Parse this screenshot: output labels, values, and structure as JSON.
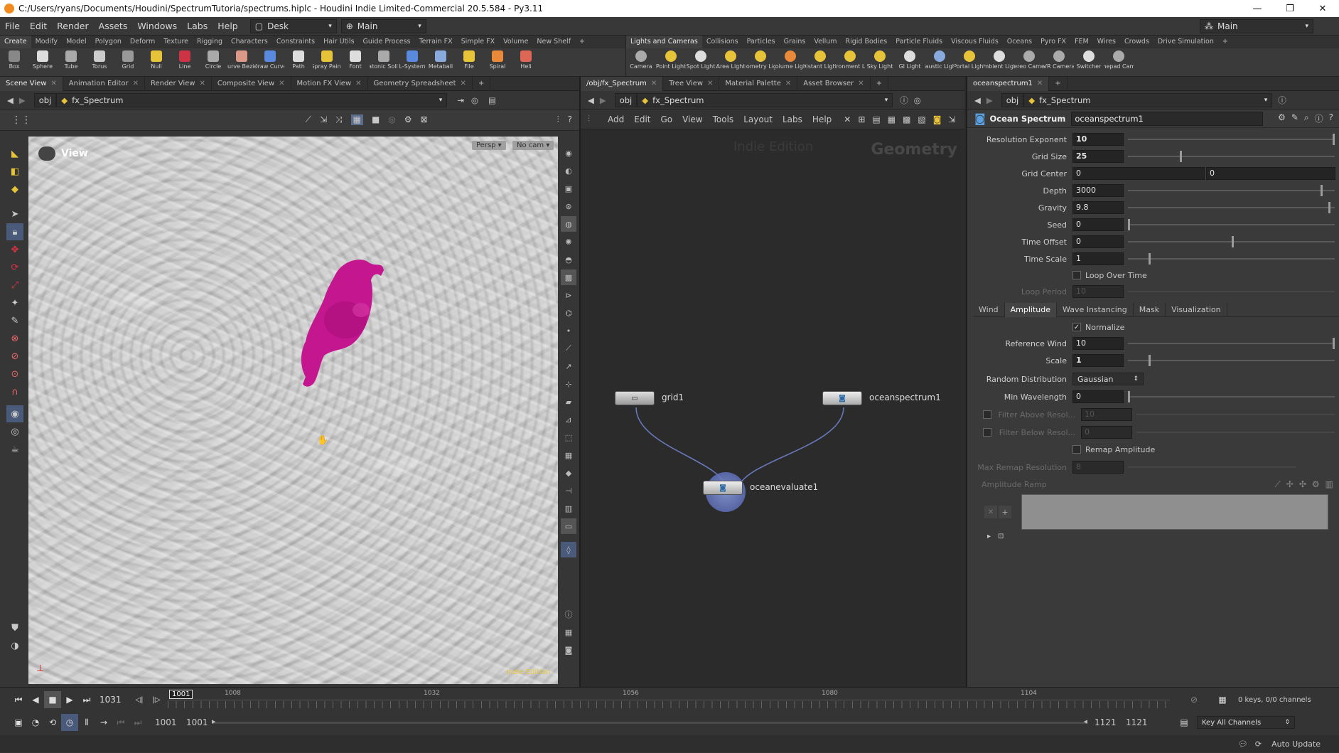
{
  "window": {
    "title": "C:/Users/ryans/Documents/Houdini/SpectrumTutoria/spectrums.hiplc - Houdini Indie Limited-Commercial 20.5.584 - Py3.11",
    "controls": [
      "—",
      "❐",
      "✕"
    ]
  },
  "menubar": {
    "items": [
      "File",
      "Edit",
      "Render",
      "Assets",
      "Windows",
      "Labs",
      "Help"
    ],
    "desktop": "Desk",
    "context": "Main",
    "right_context": "Main"
  },
  "shelf_left": {
    "tabs": [
      "Create",
      "Modify",
      "Model",
      "Polygon",
      "Deform",
      "Texture",
      "Rigging",
      "Characters",
      "Constraints",
      "Hair Utils",
      "Guide Process",
      "Terrain FX",
      "Simple FX",
      "Volume",
      "New Shelf"
    ],
    "tools": [
      "Box",
      "Sphere",
      "Tube",
      "Torus",
      "Grid",
      "Null",
      "Line",
      "Circle",
      "Curve Bezier",
      "Draw Curve",
      "Path",
      "Spray Paint",
      "Font",
      "Platonic Solids",
      "L-System",
      "Metaball",
      "File",
      "Spiral",
      "Heli"
    ]
  },
  "shelf_right": {
    "tabs": [
      "Lights and Cameras",
      "Collisions",
      "Particles",
      "Grains",
      "Vellum",
      "Rigid Bodies",
      "Particle Fluids",
      "Viscous Fluids",
      "Oceans",
      "Pyro FX",
      "FEM",
      "Wires",
      "Crowds",
      "Drive Simulation"
    ],
    "tools": [
      "Camera",
      "Point Light",
      "Spot Light",
      "Area Light",
      "Geometry Light",
      "Volume Light",
      "Distant Light",
      "Environment Light",
      "Sky Light",
      "GI Light",
      "Caustic Light",
      "Portal Light",
      "Ambient Light",
      "Stereo Camera",
      "VR Camera",
      "Switcher",
      "Gamepad Camera"
    ]
  },
  "left_pane": {
    "tabs": [
      "Scene View",
      "Animation Editor",
      "Render View",
      "Composite View",
      "Motion FX View",
      "Geometry Spreadsheet"
    ],
    "path": [
      "obj",
      "fx_Spectrum"
    ],
    "viewport_label": "View",
    "persp": "Persp ▾",
    "cam": "No cam ▾",
    "watermark": "Indie Edition"
  },
  "network_pane": {
    "tabs": [
      "/obj/fx_Spectrum",
      "Tree View",
      "Material Palette",
      "Asset Browser"
    ],
    "path": [
      "obj",
      "fx_Spectrum"
    ],
    "menu": [
      "Add",
      "Edit",
      "Go",
      "View",
      "Tools",
      "Layout",
      "Labs",
      "Help"
    ],
    "watermark": "Indie Edition",
    "context_label": "Geometry",
    "nodes": {
      "grid": "grid1",
      "spectrum": "oceanspectrum1",
      "evaluate": "oceanevaluate1"
    }
  },
  "params_pane": {
    "tab": "oceanspectrum1",
    "path": [
      "obj",
      "fx_Spectrum"
    ],
    "node_type": "Ocean Spectrum",
    "node_name": "oceanspectrum1",
    "params": {
      "resolution_exponent": {
        "label": "Resolution Exponent",
        "value": "10"
      },
      "grid_size": {
        "label": "Grid Size",
        "value": "25"
      },
      "grid_center": {
        "label": "Grid Center",
        "value": "0",
        "value2": "0"
      },
      "depth": {
        "label": "Depth",
        "value": "3000"
      },
      "gravity": {
        "label": "Gravity",
        "value": "9.8"
      },
      "seed": {
        "label": "Seed",
        "value": "0"
      },
      "time_offset": {
        "label": "Time Offset",
        "value": "0"
      },
      "time_scale": {
        "label": "Time Scale",
        "value": "1"
      },
      "loop_over_time": "Loop Over Time",
      "loop_period": {
        "label": "Loop Period",
        "value": "10"
      }
    },
    "subtabs": [
      "Wind",
      "Amplitude",
      "Wave Instancing",
      "Mask",
      "Visualization"
    ],
    "amplitude": {
      "normalize": "Normalize",
      "reference_wind": {
        "label": "Reference Wind",
        "value": "10"
      },
      "scale": {
        "label": "Scale",
        "value": "1"
      },
      "random_distribution": {
        "label": "Random Distribution",
        "value": "Gaussian"
      },
      "min_wavelength": {
        "label": "Min Wavelength",
        "value": "0"
      },
      "filter_above": {
        "label": "Filter Above Resol...",
        "value": "10"
      },
      "filter_below": {
        "label": "Filter Below Resol...",
        "value": "0"
      },
      "remap_amplitude": "Remap Amplitude",
      "max_remap": {
        "label": "Max Remap Resolution",
        "value": "8"
      },
      "ramp_label": "Amplitude Ramp"
    }
  },
  "timeline": {
    "current_frame": "1031",
    "frame_box": "1001",
    "ticks": [
      "1008",
      "1032",
      "1056",
      "1080",
      "1104"
    ],
    "start": "1001",
    "start2": "1001",
    "end": "1121",
    "end2": "1121",
    "keys": "0 keys, 0/0 channels",
    "key_all": "Key All Channels",
    "auto_update": "Auto Update"
  },
  "colors": {
    "creature": "#c3168f",
    "wire": "#6878b8",
    "accent_yellow": "#e7c33a"
  }
}
